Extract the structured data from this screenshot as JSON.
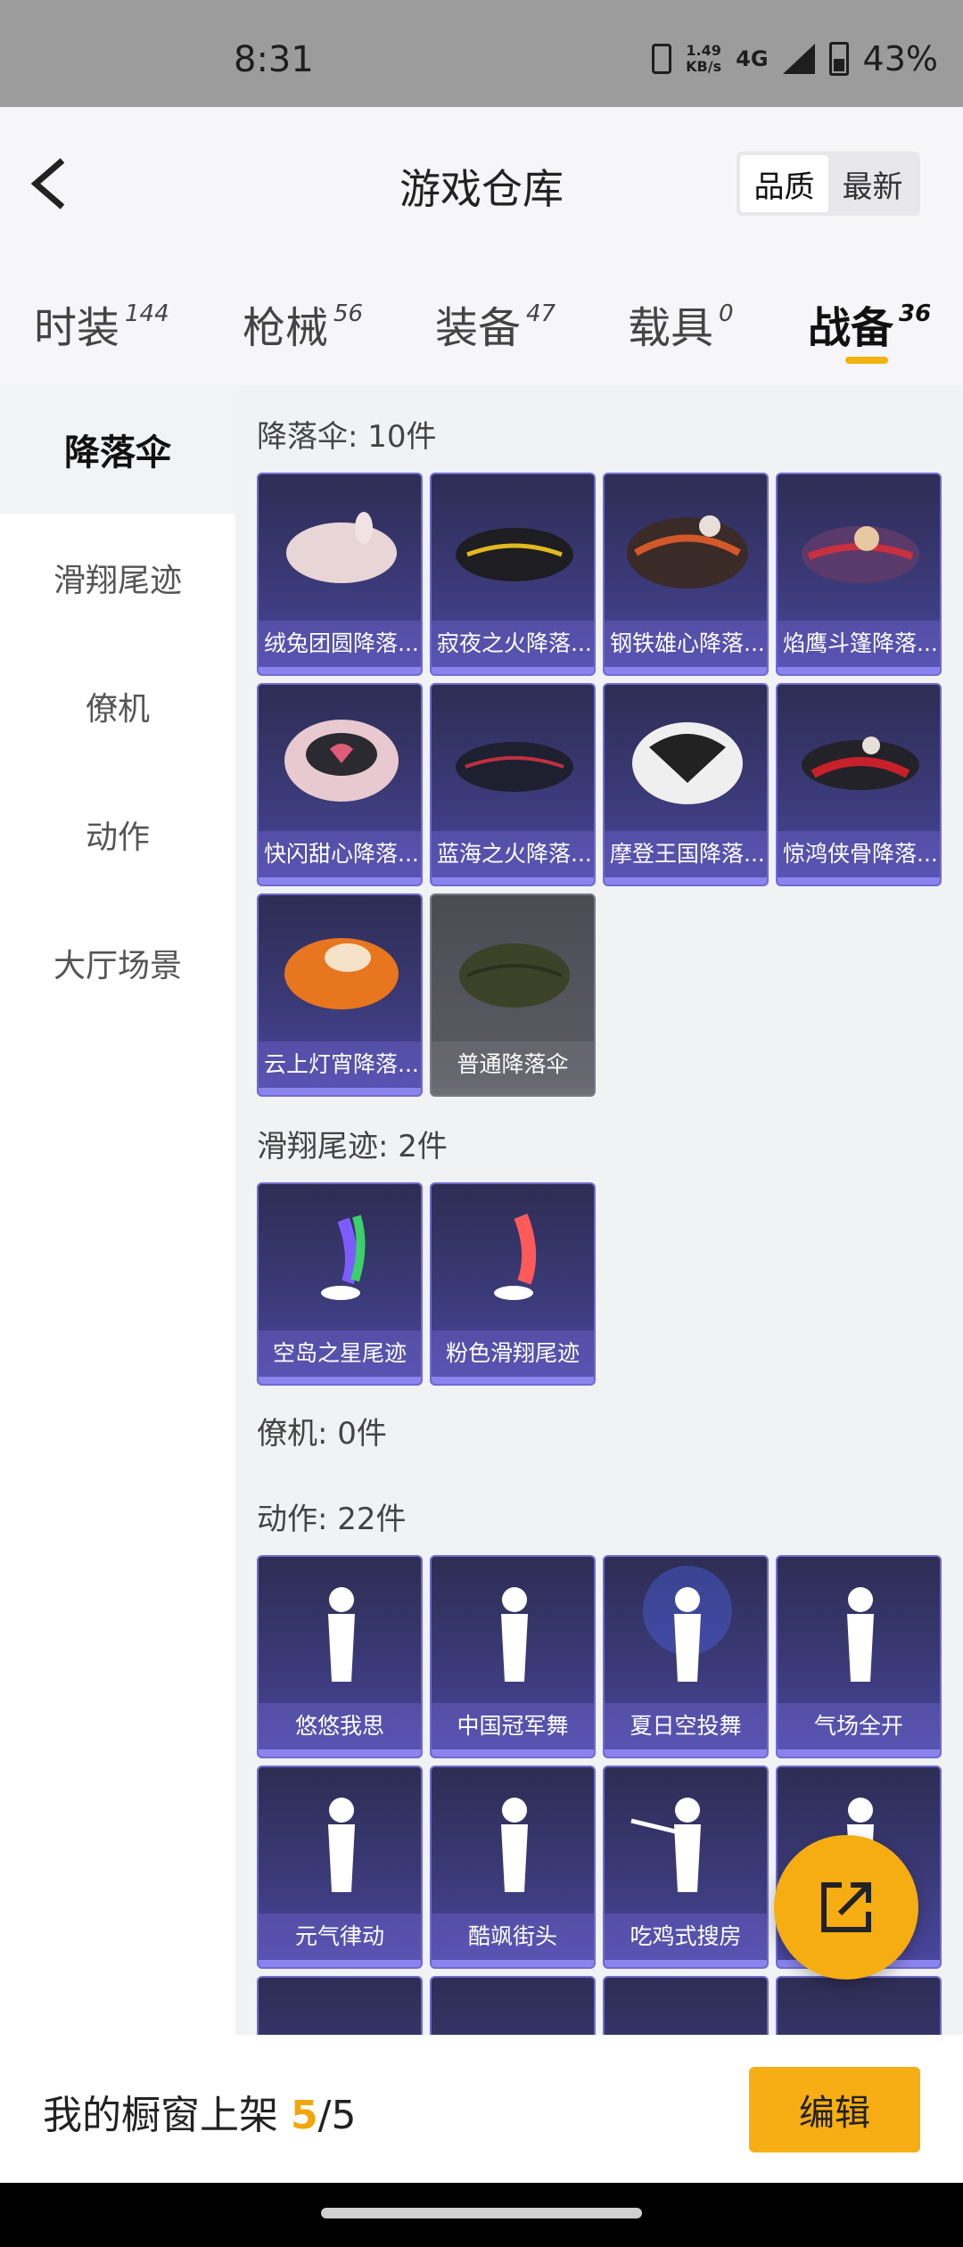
{
  "status_bar": {
    "time": "8:31",
    "net_speed_value": "1.49",
    "net_speed_unit": "KB/s",
    "network": "4G",
    "battery": "43%"
  },
  "header": {
    "title": "游戏仓库",
    "sort_options": [
      "品质",
      "最新"
    ],
    "active_sort": "品质"
  },
  "tabs": [
    {
      "label": "时装",
      "count": "144"
    },
    {
      "label": "枪械",
      "count": "56"
    },
    {
      "label": "装备",
      "count": "47"
    },
    {
      "label": "载具",
      "count": "0"
    },
    {
      "label": "战备",
      "count": "36"
    }
  ],
  "active_tab": "战备",
  "sidebar": {
    "items": [
      "降落伞",
      "滑翔尾迹",
      "僚机",
      "动作",
      "大厅场景"
    ],
    "active": "降落伞"
  },
  "sections": {
    "parachute": {
      "title": "降落伞: 10件",
      "items": [
        "绒兔团圆降落...",
        "寂夜之火降落...",
        "钢铁雄心降落...",
        "焰鹰斗篷降落...",
        "快闪甜心降落...",
        "蓝海之火降落...",
        "摩登王国降落...",
        "惊鸿侠骨降落...",
        "云上灯宵降落...",
        "普通降落伞"
      ]
    },
    "trail": {
      "title": "滑翔尾迹: 2件",
      "items": [
        "空岛之星尾迹",
        "粉色滑翔尾迹"
      ]
    },
    "wingman": {
      "title": "僚机: 0件"
    },
    "emote": {
      "title": "动作: 22件",
      "items": [
        "悠悠我思",
        "中国冠军舞",
        "夏日空投舞",
        "气场全开",
        "元气律动",
        "酷飒街头",
        "吃鸡式搜房"
      ]
    }
  },
  "bottom_bar": {
    "label": "我的橱窗上架",
    "current": "5",
    "separator_total": "/5",
    "edit_button": "编辑"
  },
  "colors": {
    "accent": "#f5ad12",
    "card_purple": "#3b3a78",
    "card_gray": "#5c5d66"
  }
}
